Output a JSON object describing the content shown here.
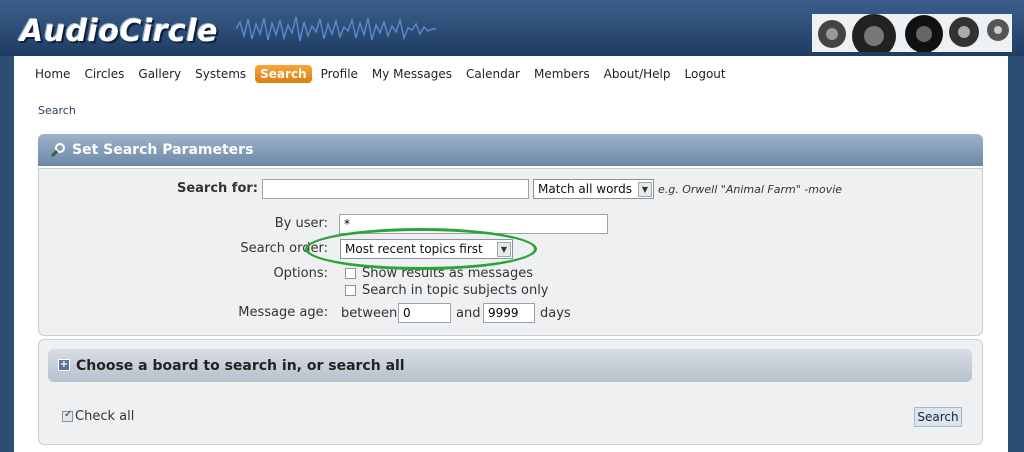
{
  "site": {
    "logo_text": "AudioCircle"
  },
  "nav": {
    "items": [
      {
        "label": "Home",
        "active": false
      },
      {
        "label": "Circles",
        "active": false
      },
      {
        "label": "Gallery",
        "active": false
      },
      {
        "label": "Systems",
        "active": false
      },
      {
        "label": "Search",
        "active": true
      },
      {
        "label": "Profile",
        "active": false
      },
      {
        "label": "My Messages",
        "active": false
      },
      {
        "label": "Calendar",
        "active": false
      },
      {
        "label": "Members",
        "active": false
      },
      {
        "label": "About/Help",
        "active": false
      },
      {
        "label": "Logout",
        "active": false
      }
    ]
  },
  "breadcrumb": "Search",
  "search_panel": {
    "title": "Set Search Parameters",
    "search_for_label": "Search for:",
    "search_for_value": "",
    "match_select": "Match all words",
    "hint": "e.g. Orwell \"Animal Farm\" -movie",
    "by_user_label": "By user:",
    "by_user_value": "*",
    "order_label": "Search order:",
    "order_select": "Most recent topics first",
    "options_label": "Options:",
    "option_messages": {
      "label": "Show results as messages",
      "checked": false
    },
    "option_subjects": {
      "label": "Search in topic subjects only",
      "checked": false
    },
    "age_label": "Message age:",
    "age_between": "between",
    "age_min": "0",
    "age_and": "and",
    "age_max": "9999",
    "age_days": "days"
  },
  "board_panel": {
    "title": "Choose a board to search in, or search all",
    "check_all_label": "Check all",
    "check_all_checked": true,
    "search_button": "Search"
  },
  "colors": {
    "header_bg": "#2e4d73",
    "active_tab": "#f39521",
    "highlight_ellipse": "#2aa53a"
  }
}
